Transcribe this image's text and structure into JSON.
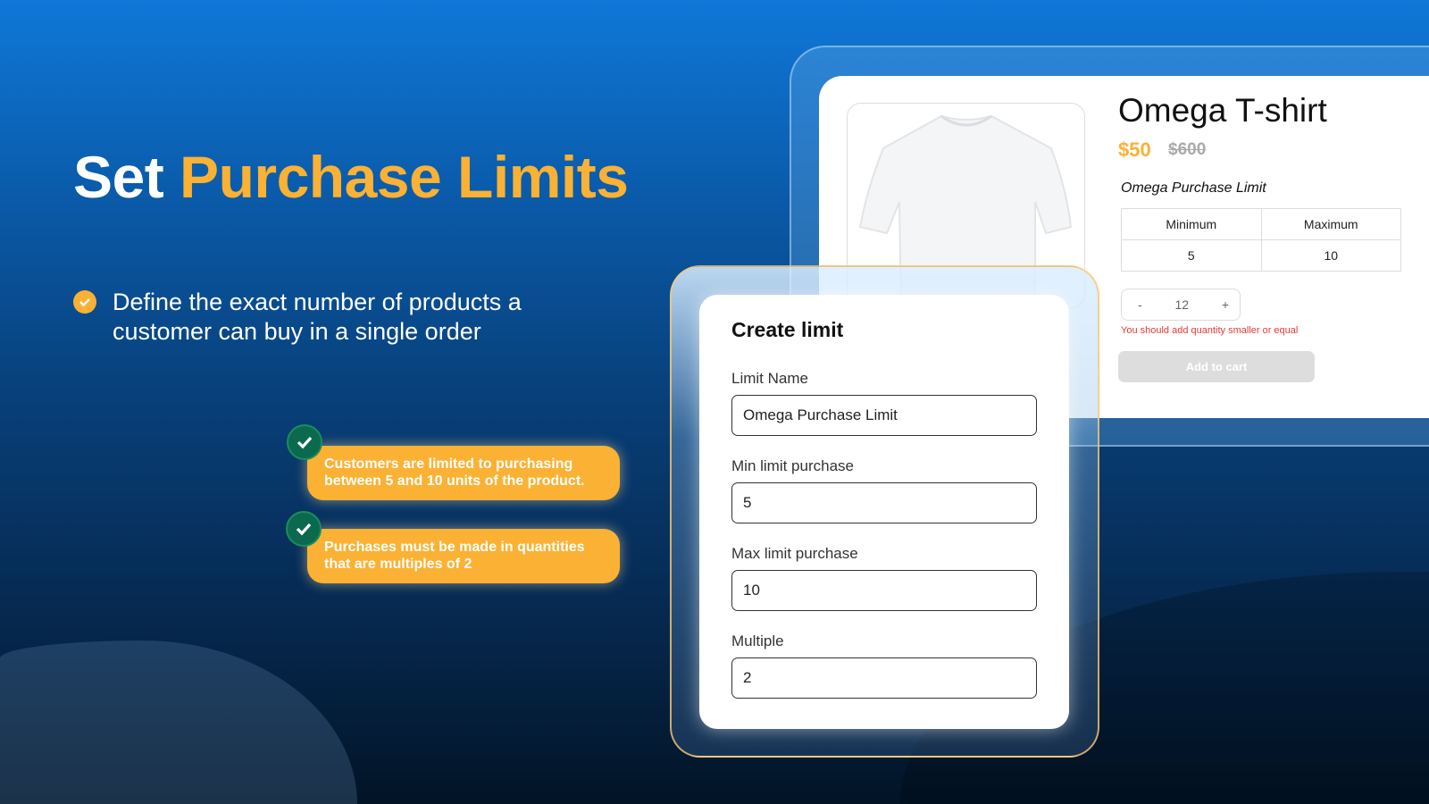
{
  "headline": {
    "prefix": "Set ",
    "highlight": "Purchase Limits"
  },
  "bullet": {
    "text": "Define the exact number of products a customer can buy in a single order",
    "line1": "Define the exact number of products a",
    "line2": "customer can buy in a single order"
  },
  "callouts": [
    {
      "line1": "Customers are limited to purchasing",
      "line2": "between 5 and 10 units of the product."
    },
    {
      "line1": "Purchases must be made in quantities",
      "line2": "that are multiples of 2"
    }
  ],
  "product": {
    "title": "Omega T-shirt",
    "price": "$50",
    "old_price": "$600",
    "limit_title": "Omega Purchase Limit",
    "table": {
      "headers": [
        "Minimum",
        "Maximum"
      ],
      "values": [
        "5",
        "10"
      ]
    },
    "quantity": {
      "minus": "-",
      "value": "12",
      "plus": "+"
    },
    "error": "You should add quantity smaller or equal",
    "add_to_cart": "Add to cart"
  },
  "form": {
    "title": "Create limit",
    "fields": [
      {
        "label": "Limit Name",
        "value": "Omega Purchase Limit"
      },
      {
        "label": "Min limit purchase",
        "value": "5"
      },
      {
        "label": "Max limit purchase",
        "value": "10"
      },
      {
        "label": "Multiple",
        "value": "2"
      }
    ]
  },
  "colors": {
    "accent": "#fbb133",
    "check_green": "#0b6a4e",
    "error": "#e53935"
  }
}
